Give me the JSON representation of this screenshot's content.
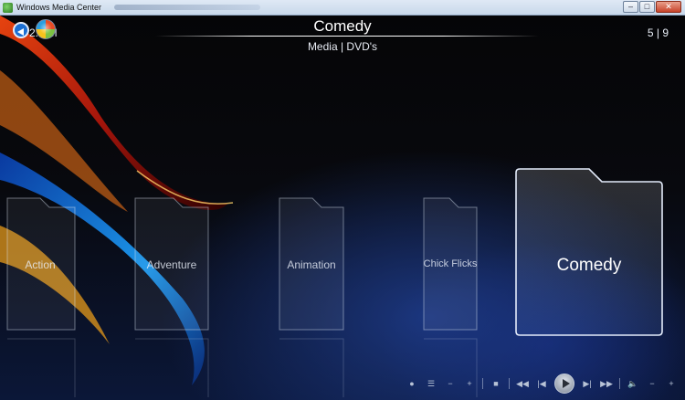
{
  "window": {
    "title": "Windows Media Center",
    "minimize": "–",
    "maximize": "□",
    "close": "✕"
  },
  "header": {
    "clock": "2:  AM",
    "title": "Comedy",
    "subtitle": "Media | DVD's",
    "counter": "5 | 9"
  },
  "tiles": [
    {
      "label": "Action"
    },
    {
      "label": "Adventure"
    },
    {
      "label": "Animation"
    },
    {
      "label": "Chick Flicks"
    },
    {
      "label": "Comedy",
      "selected": true
    }
  ],
  "transport": {
    "record": "●",
    "guide": "☰",
    "channel_down": "−",
    "channel_up": "+",
    "stop": "■",
    "rewind": "◀◀",
    "previous": "|◀",
    "play": "play-icon",
    "next": "▶|",
    "fast_forward": "▶▶",
    "mute": "🔈",
    "volume_down": "−",
    "volume_up": "+"
  },
  "colors": {
    "accent": "#1c6fd3",
    "background": "#000000"
  }
}
